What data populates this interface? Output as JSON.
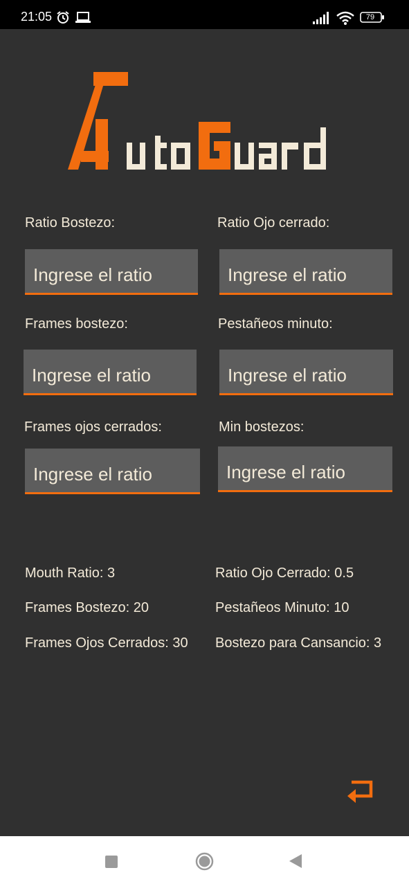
{
  "status_bar": {
    "time": "21:05",
    "battery": "79",
    "icons": [
      "alarm-icon",
      "laptop-icon",
      "signal-icon",
      "wifi-icon",
      "battery-icon"
    ]
  },
  "logo": {
    "text": "AutoGuard",
    "colors": {
      "accent": "#f26d0f",
      "cream": "#f3ead8"
    }
  },
  "form": {
    "fields": [
      {
        "label": "Ratio Bostezo:",
        "placeholder": "Ingrese el ratio"
      },
      {
        "label": "Ratio Ojo cerrado:",
        "placeholder": "Ingrese el ratio"
      },
      {
        "label": "Frames bostezo:",
        "placeholder": "Ingrese el ratio"
      },
      {
        "label": "Pestañeos minuto:",
        "placeholder": "Ingrese el ratio"
      },
      {
        "label": "Frames ojos cerrados:",
        "placeholder": "Ingrese el ratio"
      },
      {
        "label": "Min bostezos:",
        "placeholder": "Ingrese el ratio"
      }
    ]
  },
  "current_values": [
    "Mouth Ratio: 3",
    "Ratio Ojo Cerrado: 0.5",
    "Frames Bostezo: 20",
    "Pestañeos Minuto: 10",
    "Frames Ojos Cerrados: 30",
    "Bostezo para Cansancio: 3"
  ],
  "actions": {
    "back_icon": "return-arrow-icon"
  },
  "nav_bar": {
    "buttons": [
      "recents-button",
      "home-button",
      "back-button"
    ]
  },
  "colors": {
    "background": "#303030",
    "input_background": "#5d5d5d",
    "accent": "#f26d0f",
    "text": "#f3ead8"
  }
}
